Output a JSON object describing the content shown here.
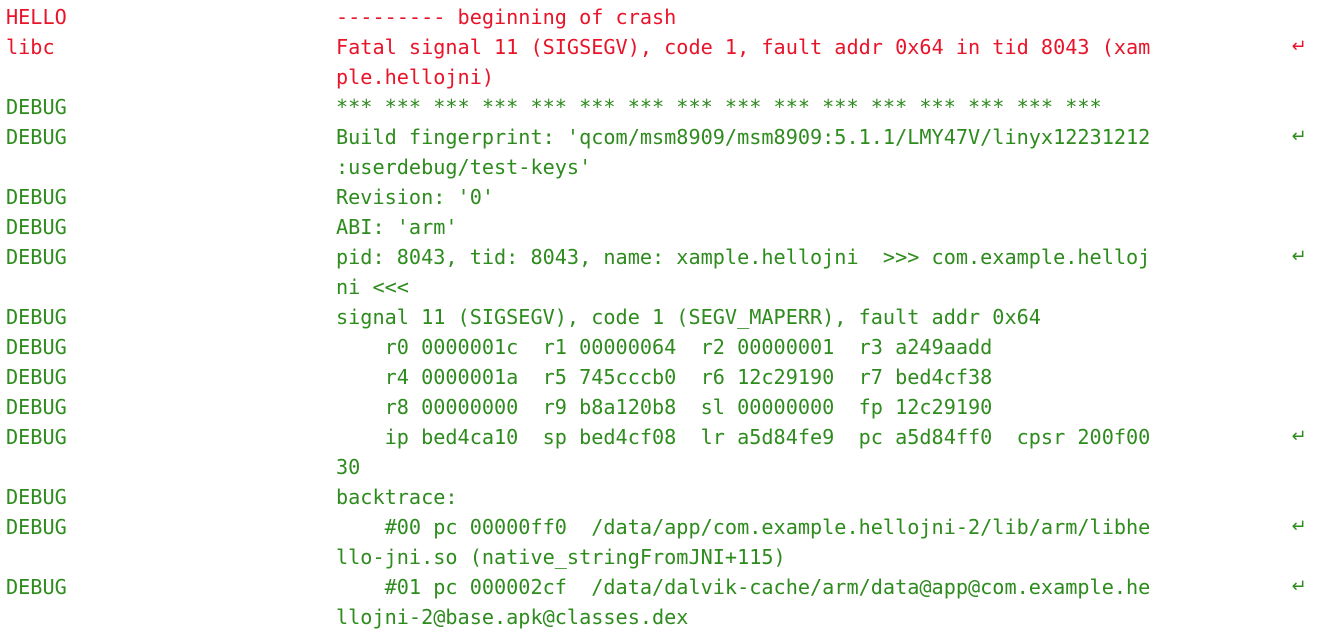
{
  "colors": {
    "error": "#e8142a",
    "debug": "#2e8b1e",
    "background": "#ffffff"
  },
  "wrap_icon": "↵",
  "entries": [
    {
      "level": "error",
      "tag": "HELLO",
      "lines": [
        "--------- beginning of crash"
      ]
    },
    {
      "level": "error",
      "tag": "libc",
      "lines": [
        "Fatal signal 11 (SIGSEGV), code 1, fault addr 0x64 in tid 8043 (xam",
        "ple.hellojni)"
      ]
    },
    {
      "level": "debug",
      "tag": "DEBUG",
      "lines": [
        "*** *** *** *** *** *** *** *** *** *** *** *** *** *** *** ***"
      ]
    },
    {
      "level": "debug",
      "tag": "DEBUG",
      "lines": [
        "Build fingerprint: 'qcom/msm8909/msm8909:5.1.1/LMY47V/linyx12231212",
        ":userdebug/test-keys'"
      ]
    },
    {
      "level": "debug",
      "tag": "DEBUG",
      "lines": [
        "Revision: '0'"
      ]
    },
    {
      "level": "debug",
      "tag": "DEBUG",
      "lines": [
        "ABI: 'arm'"
      ]
    },
    {
      "level": "debug",
      "tag": "DEBUG",
      "lines": [
        "pid: 8043, tid: 8043, name: xample.hellojni  >>> com.example.helloj",
        "ni <<<"
      ]
    },
    {
      "level": "debug",
      "tag": "DEBUG",
      "lines": [
        "signal 11 (SIGSEGV), code 1 (SEGV_MAPERR), fault addr 0x64"
      ]
    },
    {
      "level": "debug",
      "tag": "DEBUG",
      "lines": [
        "    r0 0000001c  r1 00000064  r2 00000001  r3 a249aadd"
      ]
    },
    {
      "level": "debug",
      "tag": "DEBUG",
      "lines": [
        "    r4 0000001a  r5 745cccb0  r6 12c29190  r7 bed4cf38"
      ]
    },
    {
      "level": "debug",
      "tag": "DEBUG",
      "lines": [
        "    r8 00000000  r9 b8a120b8  sl 00000000  fp 12c29190"
      ]
    },
    {
      "level": "debug",
      "tag": "DEBUG",
      "lines": [
        "    ip bed4ca10  sp bed4cf08  lr a5d84fe9  pc a5d84ff0  cpsr 200f00",
        "30"
      ]
    },
    {
      "level": "debug",
      "tag": "DEBUG",
      "lines": [
        "backtrace:"
      ]
    },
    {
      "level": "debug",
      "tag": "DEBUG",
      "lines": [
        "    #00 pc 00000ff0  /data/app/com.example.hellojni-2/lib/arm/libhe",
        "llo-jni.so (native_stringFromJNI+115)"
      ]
    },
    {
      "level": "debug",
      "tag": "DEBUG",
      "lines": [
        "    #01 pc 000002cf  /data/dalvik-cache/arm/data@app@com.example.he",
        "llojni-2@base.apk@classes.dex"
      ]
    }
  ]
}
